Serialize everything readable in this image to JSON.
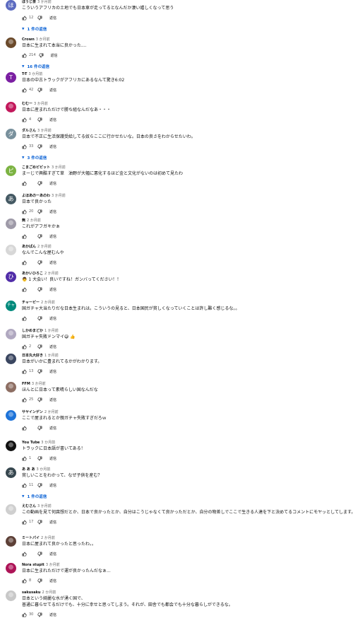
{
  "ui": {
    "reply_label": "返信"
  },
  "comments": [
    {
      "author": "ほうじ茶",
      "time": "3 か月前",
      "text": [
        "こういうアフリカの土地でも日本車が走ってるとなんだか凄い嬉しくなって思う"
      ],
      "likes": "12",
      "replies": "1 件の返信",
      "avatar": {
        "type": "letter",
        "char": "ほ",
        "color": "#5c6bc0"
      }
    },
    {
      "author": "Crown",
      "time": "3 か月前",
      "text": [
        "日本に生まれて本当に良かった...."
      ],
      "likes": "214",
      "replies": "16 件の返信",
      "avatar": {
        "type": "image",
        "color": "#6b4a2b"
      }
    },
    {
      "author": "T-T",
      "time": "3 か月前",
      "text": [
        "日本の中古トラックがアフリカにあるなんて驚き6:02"
      ],
      "likes": "42",
      "avatar": {
        "type": "letter",
        "char": "T",
        "color": "#7b1fa2"
      }
    },
    {
      "author": "むむー",
      "time": "3 か月前",
      "text": [
        "日本に産まれただけで勝ち組なんだなあ・・・"
      ],
      "likes": "4",
      "avatar": {
        "type": "image",
        "color": "#c2185b"
      }
    },
    {
      "author": "ダルさん",
      "time": "3 か月前",
      "text": [
        "日本で不正に生活保護受給してる奴らここに行かせたいな。日本の良さをわからせたいわ。"
      ],
      "likes": "33",
      "replies": "3 件の返信",
      "avatar": {
        "type": "letter",
        "char": "ダ",
        "color": "#78909c"
      }
    },
    {
      "author": "こまごめピピット",
      "time": "3 か月前",
      "text": [
        "まーじで興酷すぎて草　油野が大幅に悪化するほど金と文化がないのは初めて見たわ"
      ],
      "likes": "",
      "avatar": {
        "type": "letter",
        "char": "ピ",
        "color": "#7cb342"
      }
    },
    {
      "author": "よほあのーあのわ",
      "time": "3 か月前",
      "text": [
        "日本で良かった"
      ],
      "likes": "20",
      "avatar": {
        "type": "letter",
        "char": "あ",
        "color": "#455a64"
      }
    },
    {
      "author": "無",
      "time": "2 か月前",
      "text": [
        "これがアフガキかぁ"
      ],
      "likes": "",
      "avatar": {
        "type": "image",
        "color": "#9e9aa8"
      }
    },
    {
      "author": "あかぱん",
      "time": "2 か月前",
      "text": [
        "なんでこんな屋むんや"
      ],
      "likes": "",
      "avatar": {
        "type": "image",
        "color": "#d7d7d7"
      }
    },
    {
      "author": "あかいひろこ",
      "time": "2 か月前",
      "text": [
        "👨 1 大会い！良いですね！ガンバってください！！"
      ],
      "likes": "",
      "avatar": {
        "type": "letter",
        "char": "ひ",
        "color": "#512da8"
      }
    },
    {
      "author": "チャーピー",
      "time": "2 か月前",
      "text": [
        "国ガチャ大当たりだな日本生まれは。こういうの見ると、日本国民が貧しくなっていくことは許し難く感じるな。。"
      ],
      "likes": "",
      "avatar": {
        "type": "letter",
        "char": "チャ",
        "color": "#00897b"
      }
    },
    {
      "author": "しかめまどか",
      "time": "1 か月前",
      "text": [
        "国ガチャ失敗ドンマイ😅 👍"
      ],
      "likes": "2",
      "avatar": {
        "type": "image",
        "color": "#b0a8c0"
      }
    },
    {
      "author": "日本丸大好き",
      "time": "1 か月前",
      "text": [
        "日本がいかに豊まれてるかがわかります。"
      ],
      "likes": "13",
      "avatar": {
        "type": "image",
        "color": "#3a4660"
      }
    },
    {
      "author": "FFM",
      "time": "3 か月前",
      "text": [
        "ほんとに日本って素晴らしい国なんだな"
      ],
      "likes": "25",
      "avatar": {
        "type": "image",
        "color": "#8d6e63"
      }
    },
    {
      "author": "サヤインゲン",
      "time": "2 か月前",
      "text": [
        "ここで屋まれるとか親ガチャ失敗すぎだろｗ"
      ],
      "likes": "",
      "avatar": {
        "type": "image",
        "color": "#1e73d8"
      }
    },
    {
      "author": "You Tube",
      "time": "3 か月前",
      "text": [
        "トラックに日本語が書いてある！"
      ],
      "likes": "1",
      "avatar": {
        "type": "image",
        "color": "#111111"
      }
    },
    {
      "author": "あ あ あ",
      "time": "3 か月前",
      "text": [
        "貧しいことをわかって、なぜ子供を産む？"
      ],
      "likes": "11",
      "replies": "1 件の返信",
      "avatar": {
        "type": "letter",
        "char": "あ",
        "color": "#37474f"
      }
    },
    {
      "author": "えむさん",
      "time": "3 か月前",
      "text": [
        "この動画を見て何腐想だとか、日本で良かったとか、自分はこうじゃなくて良かっただとか、自分の物差しでここで生きる人達を下と決めてるコメントにモヤッとしてします。。"
      ],
      "likes": "17",
      "avatar": {
        "type": "image",
        "color": "#cfcfcf"
      }
    },
    {
      "author": "ミートパイ",
      "time": "2 か月前",
      "text": [
        "日本に屋まれて良かったと思ったわ。。"
      ],
      "likes": "",
      "avatar": {
        "type": "image",
        "color": "#5d4037"
      }
    },
    {
      "author": "Nora stupit",
      "time": "3 か月前",
      "text": [
        "日本に生まれただけで運が良かったんだなぁ..."
      ],
      "likes": "8",
      "avatar": {
        "type": "image",
        "color": "#ad1457"
      }
    },
    {
      "author": "sakusaku",
      "time": "2 か月前",
      "text": [
        "日本という綺麗な水が湧く国で、",
        "普通に暮らせてるだけでも、十分に幸せと思ってしまう。それが、田舎でも都会でも十分な暮らしができるな。"
      ],
      "likes": "30",
      "avatar": {
        "type": "image",
        "color": "#c8c8c8"
      }
    }
  ]
}
